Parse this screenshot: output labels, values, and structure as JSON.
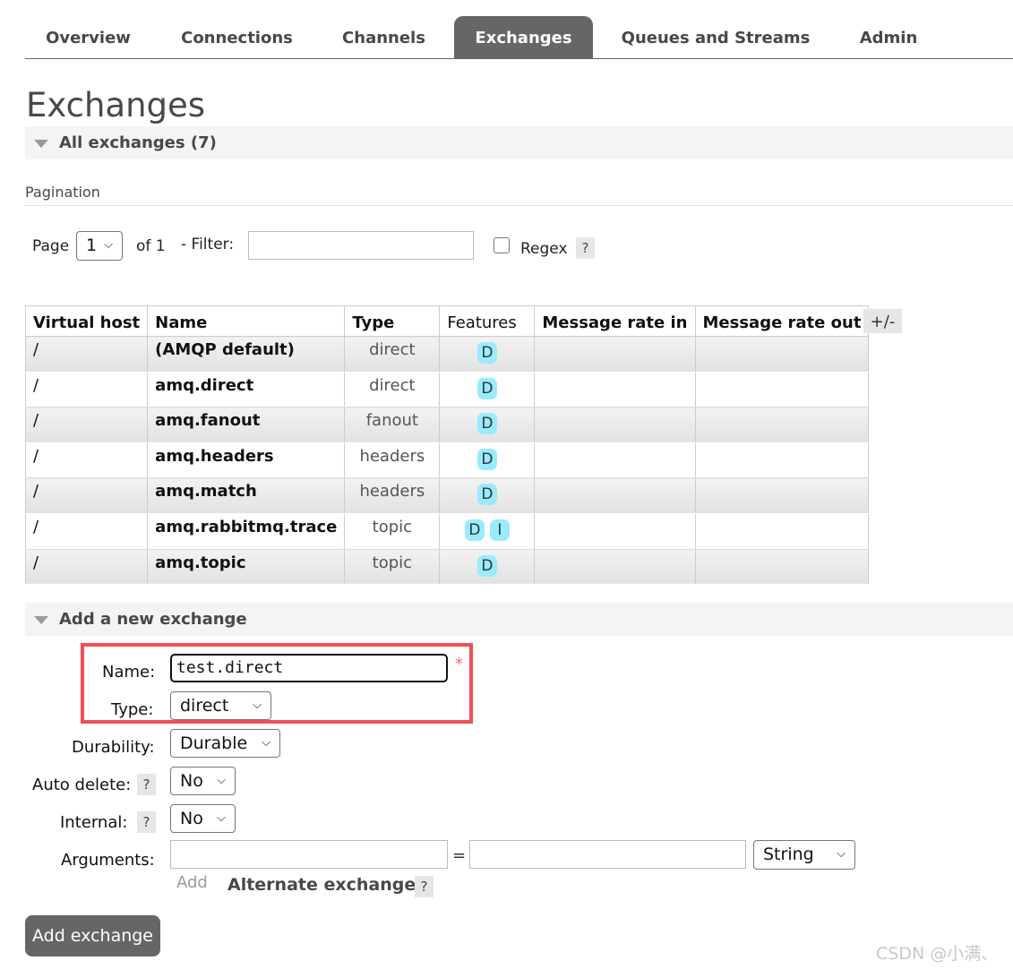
{
  "nav": {
    "tabs": [
      {
        "label": "Overview"
      },
      {
        "label": "Connections"
      },
      {
        "label": "Channels"
      },
      {
        "label": "Exchanges",
        "active": true
      },
      {
        "label": "Queues and Streams"
      },
      {
        "label": "Admin"
      }
    ]
  },
  "page": {
    "title": "Exchanges",
    "section_all": "All exchanges (7)",
    "pagination_heading": "Pagination"
  },
  "filter": {
    "page_label": "Page",
    "page_value": "1",
    "of_label": "of 1",
    "filter_label": "- Filter:",
    "filter_value": "",
    "regex_label": "Regex",
    "regex_checked": false,
    "help": "?"
  },
  "table": {
    "columns": [
      "Virtual host",
      "Name",
      "Type",
      "Features",
      "Message rate in",
      "Message rate out"
    ],
    "toggle_label": "+/-",
    "rows": [
      {
        "vhost": "/",
        "name": "(AMQP default)",
        "type": "direct",
        "features": [
          "D"
        ]
      },
      {
        "vhost": "/",
        "name": "amq.direct",
        "type": "direct",
        "features": [
          "D"
        ]
      },
      {
        "vhost": "/",
        "name": "amq.fanout",
        "type": "fanout",
        "features": [
          "D"
        ]
      },
      {
        "vhost": "/",
        "name": "amq.headers",
        "type": "headers",
        "features": [
          "D"
        ]
      },
      {
        "vhost": "/",
        "name": "amq.match",
        "type": "headers",
        "features": [
          "D"
        ]
      },
      {
        "vhost": "/",
        "name": "amq.rabbitmq.trace",
        "type": "topic",
        "features": [
          "D",
          "I"
        ]
      },
      {
        "vhost": "/",
        "name": "amq.topic",
        "type": "topic",
        "features": [
          "D"
        ]
      }
    ]
  },
  "add_exchange": {
    "section_label": "Add a new exchange",
    "name_label": "Name:",
    "name_value": "test.direct",
    "required_mark": "*",
    "type_label": "Type:",
    "type_value": "direct",
    "durability_label": "Durability:",
    "durability_value": "Durable",
    "auto_delete_label": "Auto delete:",
    "auto_delete_value": "No",
    "internal_label": "Internal:",
    "internal_value": "No",
    "arguments_label": "Arguments:",
    "arguments_key": "",
    "equals": "=",
    "arguments_value": "",
    "arguments_type": "String",
    "add_link": "Add",
    "alternate_exchange_link": "Alternate exchange",
    "help": "?",
    "submit_label": "Add exchange"
  },
  "watermark": "CSDN @小满、",
  "colors": {
    "tab_active_bg": "#666666",
    "highlight_border": "#ef4f57",
    "feature_badge": "#99ebff",
    "section_bar": "#f4f4f4"
  }
}
